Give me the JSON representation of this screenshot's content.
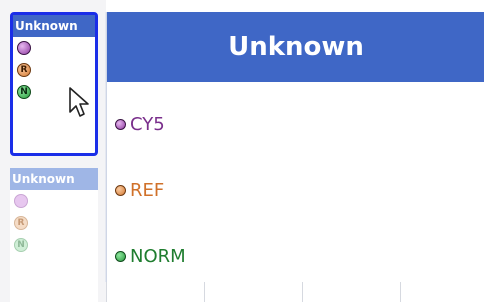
{
  "cells": {
    "selected": {
      "header": "Unknown",
      "markers": [
        {
          "icon": "purple-dot-icon",
          "letter": ""
        },
        {
          "icon": "orange-r-dot-icon",
          "letter": "R"
        },
        {
          "icon": "green-n-dot-icon",
          "letter": "N"
        }
      ]
    },
    "faded": {
      "header": "Unknown",
      "markers": [
        {
          "icon": "purple-dot-icon",
          "letter": ""
        },
        {
          "icon": "orange-r-dot-icon",
          "letter": "R"
        },
        {
          "icon": "green-n-dot-icon",
          "letter": "N"
        }
      ]
    }
  },
  "popup": {
    "title": "Unknown",
    "channels": [
      {
        "label": "CY5",
        "color": "#7a2f8c"
      },
      {
        "label": "REF",
        "color": "#d0712a"
      },
      {
        "label": "NORM",
        "color": "#1f7d2f"
      }
    ]
  },
  "colors": {
    "header_blue": "#3f67c6",
    "selection_border": "#1a2ee8"
  }
}
